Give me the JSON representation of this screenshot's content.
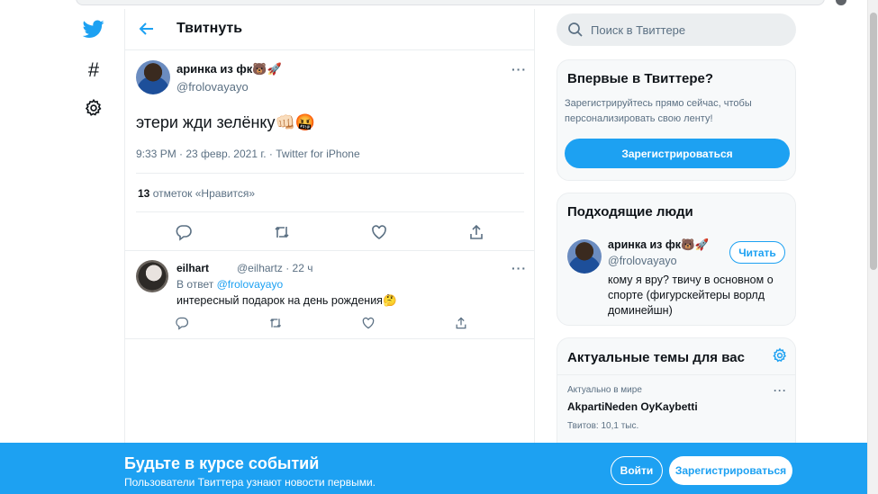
{
  "colors": {
    "accent": "#1da1f2",
    "text_secondary": "#5b7083",
    "border": "#ebeef0"
  },
  "nav": {
    "icons": [
      "twitter-logo-icon",
      "hashtag-icon",
      "gear-icon"
    ],
    "explore_symbol": "#"
  },
  "header": {
    "title": "Твитнуть"
  },
  "tweet": {
    "author_name": "аринка из фк🐻🚀",
    "author_handle": "@frolovayayo",
    "text": "этери жди зелёнку👊🏻🤬",
    "meta": "9:33 PM · 23 февр. 2021 г. · Twitter for iPhone",
    "likes_count": "13",
    "likes_label": "отметок «Нравится»",
    "more_glyph": "···"
  },
  "reply": {
    "author_name": "eilhart",
    "author_handle": "@eilhartz · 22 ч",
    "reply_to_prefix": "В ответ",
    "reply_to_handle": "@frolovayayo",
    "text": "интересный подарок на день рождения🤔"
  },
  "search": {
    "placeholder": "Поиск в Твиттере"
  },
  "signup_card": {
    "title": "Впервые в Твиттере?",
    "text": "Зарегистрируйтесь прямо сейчас, чтобы персонализировать свою ленту!",
    "button": "Зарегистрироваться"
  },
  "who_to_follow": {
    "title": "Подходящие люди",
    "name": "аринка из фк🐻🚀",
    "handle": "@frolovayayo",
    "follow_button": "Читать",
    "bio": "кому я вру? твичу в основном о спорте (фигурскейтеры ворлд доминейшн)"
  },
  "trends": {
    "title": "Актуальные темы для вас",
    "context": "Актуально в мире",
    "name": "AkpartiNeden OyKaybetti",
    "count": "Твитов: 10,1 тыс."
  },
  "banner": {
    "title": "Будьте в курсе событий",
    "subtitle": "Пользователи Твиттера узнают новости первыми.",
    "login_button": "Войти",
    "register_button": "Зарегистрироваться"
  }
}
